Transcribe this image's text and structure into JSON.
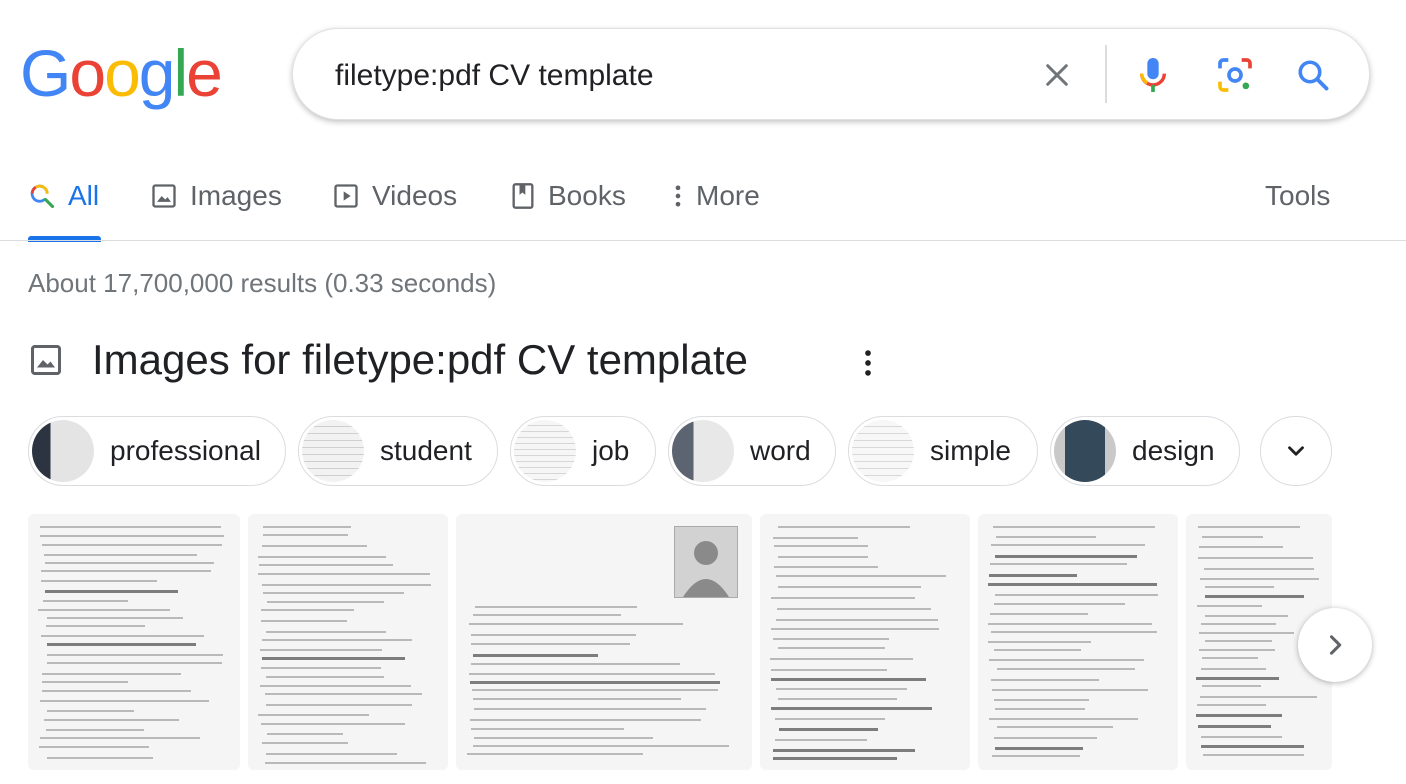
{
  "logo": {
    "letters": [
      "G",
      "o",
      "o",
      "g",
      "l",
      "e"
    ],
    "colors": [
      "#4285f4",
      "#ea4335",
      "#fbbc05",
      "#4285f4",
      "#34a853",
      "#ea4335"
    ]
  },
  "search": {
    "value": "filetype:pdf CV template"
  },
  "tabs": [
    {
      "label": "All",
      "icon": "search-icon",
      "active": true
    },
    {
      "label": "Images",
      "icon": "image-icon"
    },
    {
      "label": "Videos",
      "icon": "play-icon"
    },
    {
      "label": "Books",
      "icon": "book-icon"
    },
    {
      "label": "More",
      "icon": "more-vert-icon"
    }
  ],
  "tools_label": "Tools",
  "results_stats": "About 17,700,000 results (0.33 seconds)",
  "images_section": {
    "title": "Images for filetype:pdf CV template",
    "chips": [
      {
        "label": "professional",
        "thumb": "dark"
      },
      {
        "label": "student",
        "thumb": "light"
      },
      {
        "label": "job",
        "thumb": "light"
      },
      {
        "label": "word",
        "thumb": "mixed"
      },
      {
        "label": "simple",
        "thumb": "light"
      },
      {
        "label": "design",
        "thumb": "dark"
      }
    ],
    "results_count": 6
  },
  "colors": {
    "accent": "#1a73e8",
    "text_secondary": "#5f6368",
    "border": "#dadce0"
  }
}
